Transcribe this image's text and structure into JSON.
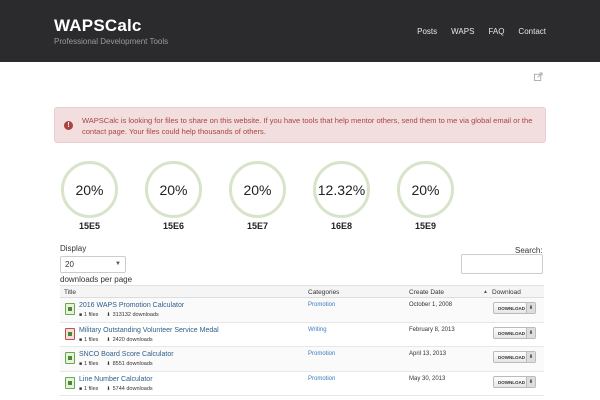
{
  "header": {
    "brand_title": "WAPSCalc",
    "tagline": "Professional Development Tools",
    "nav": [
      "Posts",
      "WAPS",
      "FAQ",
      "Contact"
    ]
  },
  "alert": {
    "text": "WAPSCalc is looking for files to share on this website. If you have tools that help mentor others, send them to me via global email or the contact page. Your files could help thousands of others."
  },
  "stats": [
    {
      "value": "20%",
      "label": "15E5"
    },
    {
      "value": "20%",
      "label": "15E6"
    },
    {
      "value": "20%",
      "label": "15E7"
    },
    {
      "value": "12.32%",
      "label": "16E8"
    },
    {
      "value": "20%",
      "label": "15E9"
    }
  ],
  "table_controls": {
    "display_label": "Display",
    "page_size": "20",
    "per_page_label": "downloads per page",
    "search_label": "Search:"
  },
  "table": {
    "headers": [
      "Title",
      "Categories",
      "Create Date",
      "Download"
    ],
    "rows": [
      {
        "title": "2016 WAPS Promotion Calculator",
        "files": "1 files",
        "downloads": "313132 downloads",
        "category": "Promotion",
        "date": "October 1, 2008",
        "button": "DOWNLOAD"
      },
      {
        "title": "Military Outstanding Volunteer Service Medal",
        "files": "1 files",
        "downloads": "2420 downloads",
        "category": "Writing",
        "date": "February 8, 2013",
        "button": "DOWNLOAD"
      },
      {
        "title": "SNCO Board Score Calculator",
        "files": "1 files",
        "downloads": "8551 downloads",
        "category": "Promotion",
        "date": "April 13, 2013",
        "button": "DOWNLOAD"
      },
      {
        "title": "Line Number Calculator",
        "files": "1 files",
        "downloads": "5744 downloads",
        "category": "Promotion",
        "date": "May 30, 2013",
        "button": "DOWNLOAD"
      }
    ]
  },
  "colors": {
    "header_bg": "#2b2b2d",
    "alert_bg": "#f2dede",
    "alert_text": "#a94442",
    "ring": "#d7e4c9",
    "link": "#2f5f8a"
  }
}
